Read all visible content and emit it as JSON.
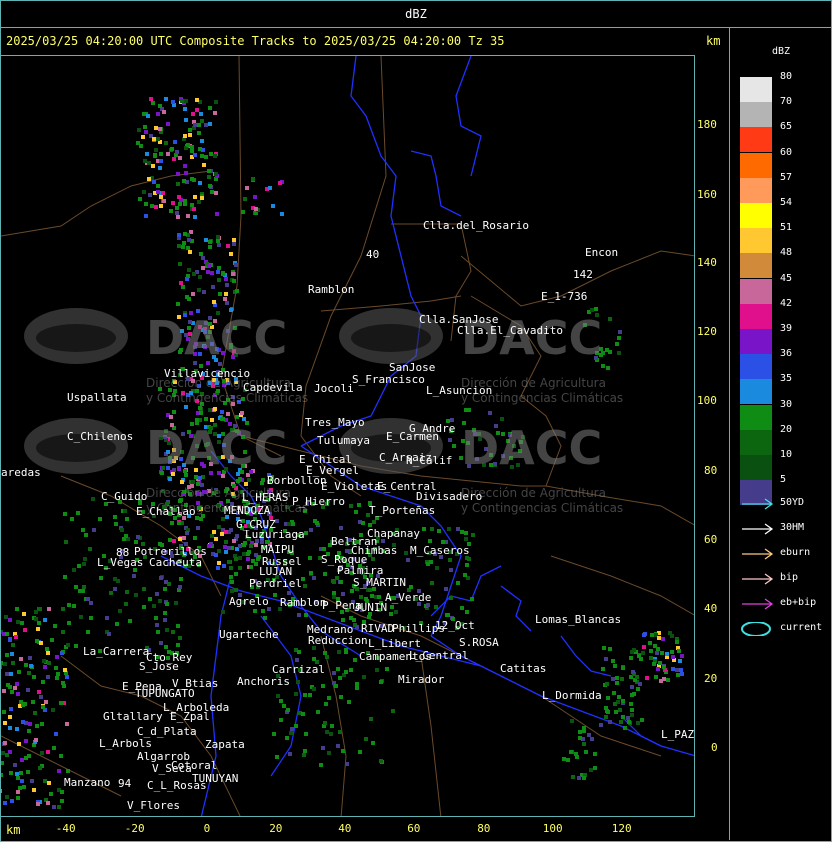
{
  "window": {
    "title": "dBZ"
  },
  "header": {
    "text": "2025/03/25 04:20:00 UTC Composite Tracks to 2025/03/25 04:20:00 Tz 35",
    "km_label": "km",
    "km_label_bottom": "km"
  },
  "axes": {
    "y_ticks": [
      "180",
      "160",
      "140",
      "120",
      "100",
      "80",
      "60",
      "40",
      "20",
      "0"
    ],
    "x_ticks": [
      "-40",
      "-20",
      "0",
      "20",
      "40",
      "60",
      "80",
      "100",
      "120"
    ]
  },
  "legend": {
    "title": "dBZ",
    "scale": [
      {
        "label": "80",
        "color": "#e6e6e6"
      },
      {
        "label": "70",
        "color": "#b4b4b4"
      },
      {
        "label": "65",
        "color": "#ff3a14"
      },
      {
        "label": "60",
        "color": "#ff6a00"
      },
      {
        "label": "57",
        "color": "#ff9a5a"
      },
      {
        "label": "54",
        "color": "#ffff00"
      },
      {
        "label": "51",
        "color": "#ffc830"
      },
      {
        "label": "48",
        "color": "#d08a3a"
      },
      {
        "label": "45",
        "color": "#c8689a"
      },
      {
        "label": "42",
        "color": "#e0108c"
      },
      {
        "label": "39",
        "color": "#7a14c8"
      },
      {
        "label": "36",
        "color": "#2a50e6"
      },
      {
        "label": "35",
        "color": "#1a8ade"
      },
      {
        "label": "30",
        "color": "#0e8c14"
      },
      {
        "label": "20",
        "color": "#0c6610"
      },
      {
        "label": "10",
        "color": "#0a5010"
      },
      {
        "label": "5",
        "color": "#463c8c"
      }
    ],
    "tracks": [
      {
        "label": "50YD",
        "color": "#40e0e0"
      },
      {
        "label": "30HM",
        "color": "#ffffff"
      },
      {
        "label": "eburn",
        "color": "#ffc87a"
      },
      {
        "label": "bip",
        "color": "#ffc8c8"
      },
      {
        "label": "eb+bip",
        "color": "#e040e0"
      },
      {
        "label": "current",
        "color": "#40e0e0"
      }
    ]
  },
  "watermark": {
    "brand": "DACC",
    "line1": "Dirección de Agricultura",
    "line2": "y Contingencias Climáticas"
  },
  "cities": [
    {
      "name": "Clla.del_Rosario"
    },
    {
      "name": "Encon"
    },
    {
      "name": "142"
    },
    {
      "name": "E_1-736"
    },
    {
      "name": "Ramblon"
    },
    {
      "name": "Clla.SanJose"
    },
    {
      "name": "Clla.El_Cavadito"
    },
    {
      "name": "40"
    },
    {
      "name": "Villavicencio"
    },
    {
      "name": "Capdevila"
    },
    {
      "name": "S_Francisco"
    },
    {
      "name": "SanJose"
    },
    {
      "name": "Uspallata"
    },
    {
      "name": "Jocoli"
    },
    {
      "name": "L_Asuncion"
    },
    {
      "name": "Tres_Mayo"
    },
    {
      "name": "C_Chilenos"
    },
    {
      "name": "Tulumaya"
    },
    {
      "name": "E_Carmen"
    },
    {
      "name": "G_Andre"
    },
    {
      "name": "aredas"
    },
    {
      "name": "E_Chical"
    },
    {
      "name": "C_Arsaiz"
    },
    {
      "name": "E_Vergel"
    },
    {
      "name": "N_Calif"
    },
    {
      "name": "Borbollon"
    },
    {
      "name": "E_Violetas"
    },
    {
      "name": "E_Central"
    },
    {
      "name": "Divisadero"
    },
    {
      "name": "C_Guido"
    },
    {
      "name": "L_HERAS"
    },
    {
      "name": "P_Hierro"
    },
    {
      "name": "E_Challao"
    },
    {
      "name": "MENDOZA"
    },
    {
      "name": "T_Porteñas"
    },
    {
      "name": "G_CRUZ"
    },
    {
      "name": "Luzuriaga"
    },
    {
      "name": "Chapanay"
    },
    {
      "name": "Beltran"
    },
    {
      "name": "Chimbas"
    },
    {
      "name": "M_Caseros"
    },
    {
      "name": "MAIPU"
    },
    {
      "name": "88"
    },
    {
      "name": "Potrerillos"
    },
    {
      "name": "Russel"
    },
    {
      "name": "L_Vegas"
    },
    {
      "name": "Cacheuta"
    },
    {
      "name": "S_Roque"
    },
    {
      "name": "LUJAN"
    },
    {
      "name": "Palmira"
    },
    {
      "name": "Perdriel"
    },
    {
      "name": "S_MARTIN"
    },
    {
      "name": "A_Verde"
    },
    {
      "name": "Agrelo"
    },
    {
      "name": "Ramblon"
    },
    {
      "name": "P_Pena"
    },
    {
      "name": "JUNIN"
    },
    {
      "name": "Lomas_Blancas"
    },
    {
      "name": "Ugarteche"
    },
    {
      "name": "RIVAD"
    },
    {
      "name": "Phillips"
    },
    {
      "name": "12_Oct"
    },
    {
      "name": "Medrano"
    },
    {
      "name": "Reduccion"
    },
    {
      "name": "L_Libert"
    },
    {
      "name": "S.ROSA"
    },
    {
      "name": "La_Carrera"
    },
    {
      "name": "Cto_Rey"
    },
    {
      "name": "S_Jose"
    },
    {
      "name": "Carrizal"
    },
    {
      "name": "Campamentos"
    },
    {
      "name": "L_Central"
    },
    {
      "name": "Catitas"
    },
    {
      "name": "E_Pena"
    },
    {
      "name": "V_Btias"
    },
    {
      "name": "Anchoris"
    },
    {
      "name": "TUPUNGATO"
    },
    {
      "name": "Mirador"
    },
    {
      "name": "L_Dormida"
    },
    {
      "name": "L_Arboleda"
    },
    {
      "name": "Gltallary"
    },
    {
      "name": "E_Zpal"
    },
    {
      "name": "C_d_Plata"
    },
    {
      "name": "L_Arbols"
    },
    {
      "name": "Zapata"
    },
    {
      "name": "L_PAZ"
    },
    {
      "name": "Algarrob"
    },
    {
      "name": "Cotoral"
    },
    {
      "name": "V_Seca"
    },
    {
      "name": "Manzano"
    },
    {
      "name": "94"
    },
    {
      "name": "TUNUYAN"
    },
    {
      "name": "C_L_Rosas"
    },
    {
      "name": "V_Flores"
    }
  ]
}
